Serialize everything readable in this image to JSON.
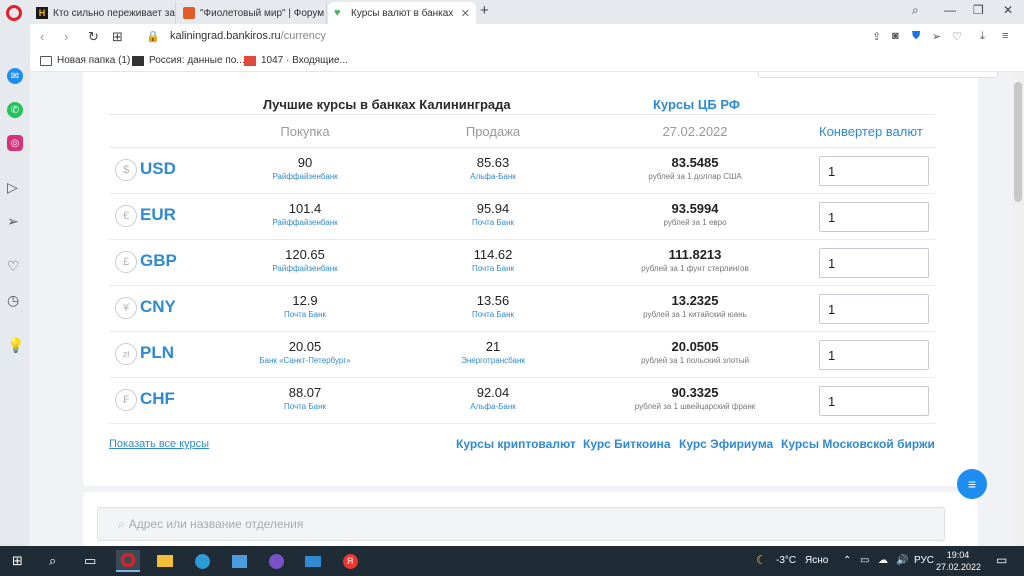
{
  "browser": {
    "tabs": [
      {
        "title": "Кто сильно переживает за",
        "icon_color": "#f2b41c"
      },
      {
        "title": "\"Фиолетовый мир\" | Форум",
        "icon_color": "#e25c2a"
      },
      {
        "title": "Курсы валют в банках Кал",
        "icon_color": "#3fb55a"
      }
    ],
    "url_domain": "kaliningrad.bankiros.ru",
    "url_path": "/currency",
    "bookmarks": [
      "Новая папка (1)",
      "Россия: данные по...",
      "1047 · Входящие..."
    ]
  },
  "page": {
    "best_rates_title": "Лучшие курсы в банках Калининграда",
    "cbr_link": "Курсы ЦБ РФ",
    "headers": {
      "buy": "Покупка",
      "sell": "Продажа",
      "date": "27.02.2022",
      "converter": "Конвертер валют"
    },
    "rows": [
      {
        "code": "USD",
        "symbol": "$",
        "buy": "90",
        "buy_bank": "Райффайзенбанк",
        "sell": "85.63",
        "sell_bank": "Альфа-Банк",
        "cbr": "83.5485",
        "cbr_desc": "рублей за 1 доллар США",
        "conv": "1"
      },
      {
        "code": "EUR",
        "symbol": "€",
        "buy": "101.4",
        "buy_bank": "Райффайзенбанк",
        "sell": "95.94",
        "sell_bank": "Почта Банк",
        "cbr": "93.5994",
        "cbr_desc": "рублей за 1 евро",
        "conv": "1"
      },
      {
        "code": "GBP",
        "symbol": "£",
        "buy": "120.65",
        "buy_bank": "Райффайзенбанк",
        "sell": "114.62",
        "sell_bank": "Почта Банк",
        "cbr": "111.8213",
        "cbr_desc": "рублей за 1 фунт стерлингов",
        "conv": "1"
      },
      {
        "code": "CNY",
        "symbol": "¥",
        "buy": "12.9",
        "buy_bank": "Почта Банк",
        "sell": "13.56",
        "sell_bank": "Почта Банк",
        "cbr": "13.2325",
        "cbr_desc": "рублей за 1 китайский юань",
        "conv": "1"
      },
      {
        "code": "PLN",
        "symbol": "zł",
        "buy": "20.05",
        "buy_bank": "Банк «Санкт-Петербург»",
        "sell": "21",
        "sell_bank": "Энерготрансбанк",
        "cbr": "20.0505",
        "cbr_desc": "рублей за 1 польский злотый",
        "conv": "1"
      },
      {
        "code": "CHF",
        "symbol": "₣",
        "buy": "88.07",
        "buy_bank": "Почта Банк",
        "sell": "92.04",
        "sell_bank": "Альфа-Банк",
        "cbr": "90.3325",
        "cbr_desc": "рублей за 1 швейцарский франк",
        "conv": "1"
      }
    ],
    "show_all": "Показать все курсы",
    "footer_links": [
      "Курсы криптовалют",
      "Курс Биткоина",
      "Курс Эфириума",
      "Курсы Московской биржи"
    ],
    "branch_search_placeholder": "Адрес или название отделения"
  },
  "taskbar": {
    "weather": "-3°C",
    "weather_text": "Ясно",
    "lang": "РУС",
    "time": "19:04",
    "date": "27.02.2022"
  }
}
